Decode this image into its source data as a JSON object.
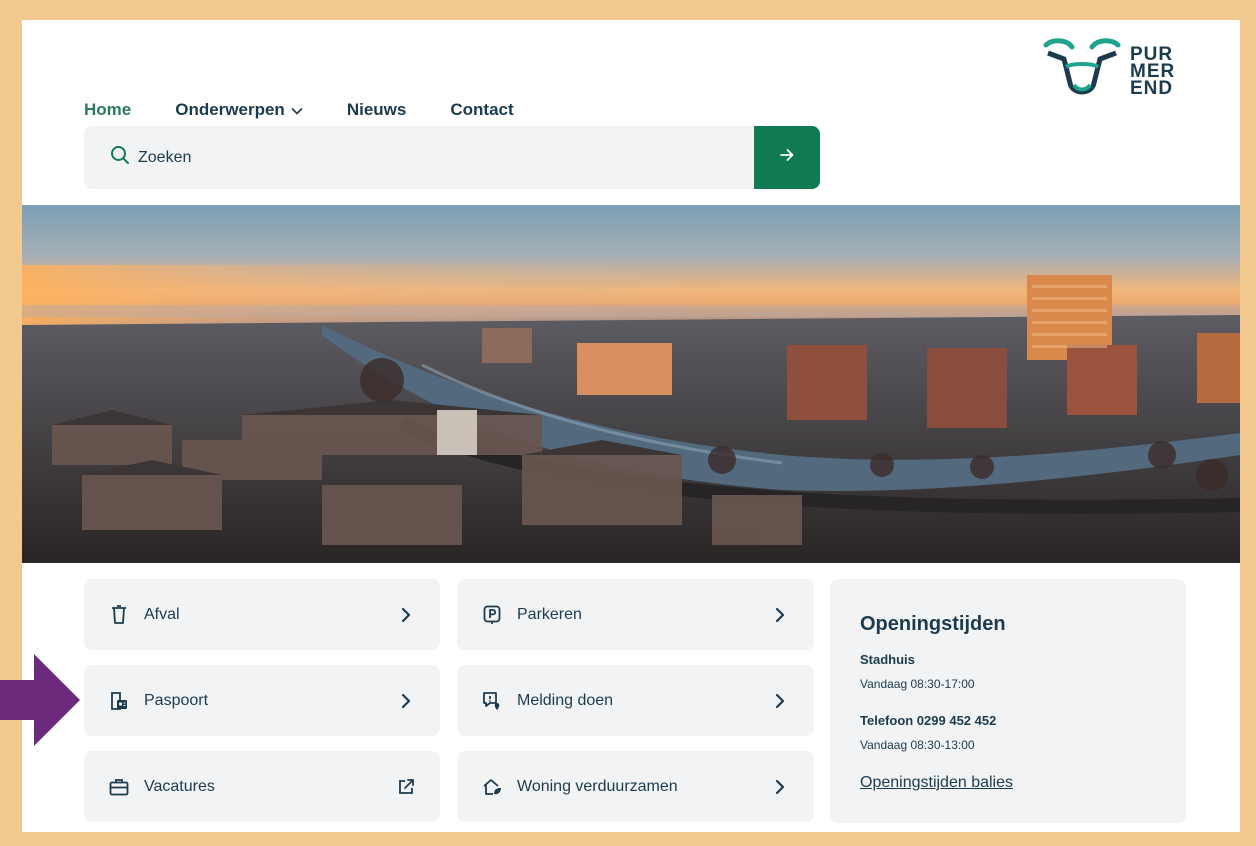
{
  "nav": {
    "home": "Home",
    "onderwerpen": "Onderwerpen",
    "nieuws": "Nieuws",
    "contact": "Contact"
  },
  "logo": {
    "line1": "PUR",
    "line2": "MER",
    "line3": "END"
  },
  "search": {
    "placeholder": "Zoeken"
  },
  "tiles": [
    {
      "label": "Afval",
      "icon": "trash-icon",
      "arrow": "chevron-right-icon"
    },
    {
      "label": "Parkeren",
      "icon": "parking-icon",
      "arrow": "chevron-right-icon"
    },
    {
      "label": "Paspoort",
      "icon": "passport-icon",
      "arrow": "chevron-right-icon"
    },
    {
      "label": "Melding doen",
      "icon": "report-icon",
      "arrow": "chevron-right-icon"
    },
    {
      "label": "Vacatures",
      "icon": "briefcase-icon",
      "arrow": "external-link-icon"
    },
    {
      "label": "Woning verduurzamen",
      "icon": "eco-house-icon",
      "arrow": "chevron-right-icon"
    }
  ],
  "opening": {
    "title": "Openingstijden",
    "stadhuis_label": "Stadhuis",
    "stadhuis_hours": "Vandaag 08:30-17:00",
    "telefoon_label": "Telefoon 0299 452 452",
    "telefoon_hours": "Vandaag 08:30-13:00",
    "link": "Openingstijden balies"
  },
  "colors": {
    "frame": "#f2c98f",
    "brand_green": "#107a53",
    "text_navy": "#1d3b4f",
    "tile_bg": "#f1f3f4",
    "highlight_arrow": "#6b2a7b"
  }
}
